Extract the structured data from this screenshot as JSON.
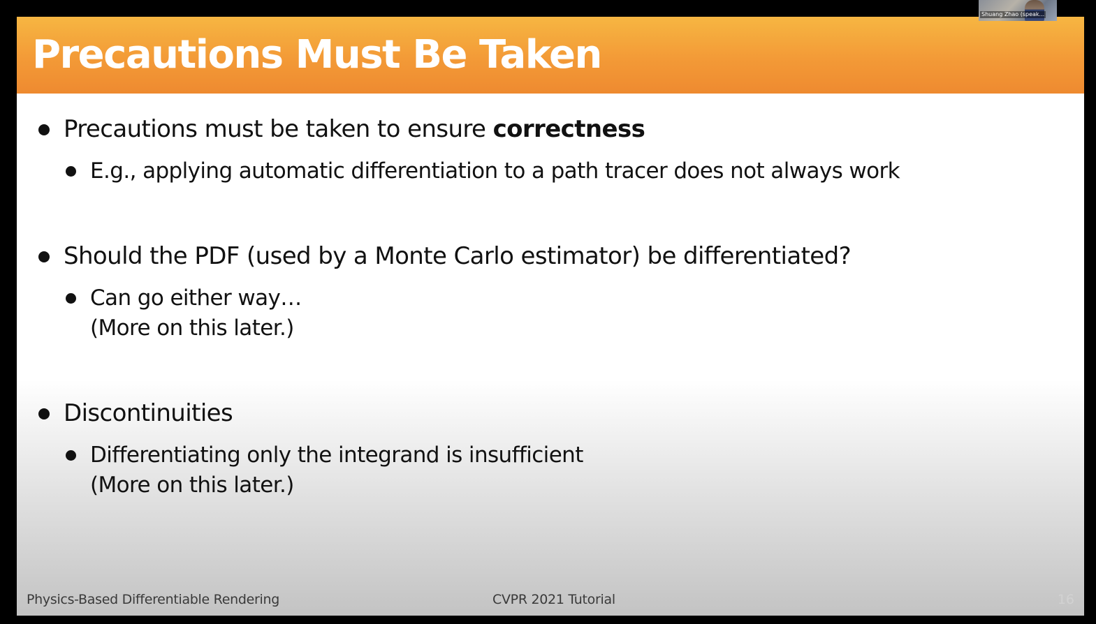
{
  "slide": {
    "title": "Precautions Must Be Taken",
    "bullets": [
      {
        "text": "Precautions must be taken to ensure ",
        "bold": "correctness",
        "sub": [
          "E.g., applying automatic differentiation to a path tracer does not always work"
        ]
      },
      {
        "text": "Should the PDF (used by a Monte Carlo estimator) be differentiated?",
        "sub_line1": "Can go either way…",
        "sub_line2": "(More on this later.)"
      },
      {
        "text": "Discontinuities",
        "sub_line1": "Differentiating only the integrand is insufficient",
        "sub_line2": "(More on this later.)"
      }
    ],
    "footer": {
      "left": "Physics-Based Differentiable Rendering",
      "center": "CVPR 2021 Tutorial",
      "page_number": "16"
    },
    "colors": {
      "title_bar_top": "#f6b642",
      "title_bar_bottom": "#ee8a30",
      "background": "#000000"
    }
  },
  "video_thumbnail": {
    "name_label": "Shuang Zhao (speak..."
  }
}
